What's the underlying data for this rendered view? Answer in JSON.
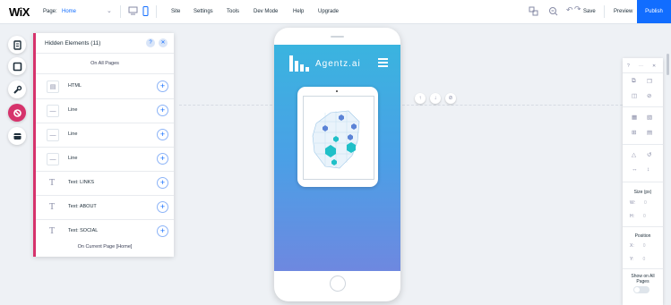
{
  "topbar": {
    "logo": "WiX",
    "page_label": "Page:",
    "page_value": "Home",
    "menu": [
      "Site",
      "Settings",
      "Tools",
      "Dev Mode",
      "Help",
      "Upgrade"
    ],
    "save": "Save",
    "preview": "Preview",
    "publish": "Publish"
  },
  "hidden_panel": {
    "title": "Hidden Elements (11)",
    "help": "?",
    "section_all": "On All Pages",
    "items": [
      {
        "icon": "html-icon",
        "label": "HTML"
      },
      {
        "icon": "line-icon",
        "label": "Line"
      },
      {
        "icon": "line-icon",
        "label": "Line"
      },
      {
        "icon": "line-icon",
        "label": "Line"
      },
      {
        "icon": "text-icon",
        "label": "Text: LINKS"
      },
      {
        "icon": "text-icon",
        "label": "Text: ABOUT"
      },
      {
        "icon": "text-icon",
        "label": "Text: SOCIAL"
      }
    ],
    "section_current": "On Current Page [Home]"
  },
  "site": {
    "brand": "Agentz.ai"
  },
  "right_panel": {
    "size_label": "Size (px)",
    "w_label": "W:",
    "w_value": "0",
    "h_label": "H:",
    "h_value": "0",
    "position_label": "Position",
    "x_label": "X:",
    "x_value": "0",
    "y_label": "Y:",
    "y_value": "0",
    "show_all_label": "Show on All Pages",
    "show_all_on": false
  },
  "colors": {
    "accent": "#116dff",
    "hidden_accent": "#d6336c"
  }
}
